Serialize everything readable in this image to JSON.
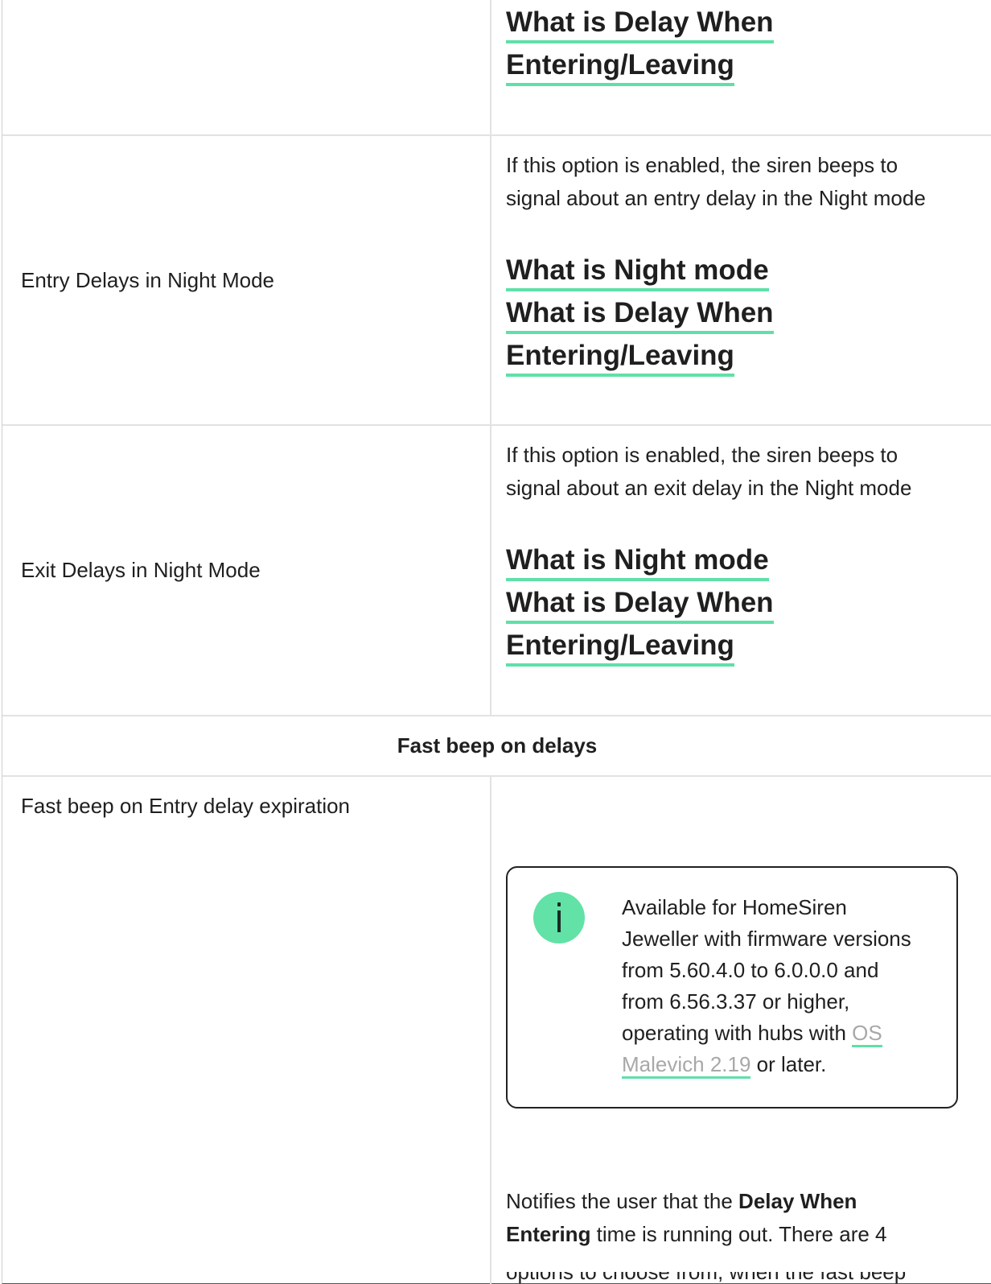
{
  "rows": {
    "top_links": [
      "What is Delay When",
      "Entering/Leaving"
    ],
    "entry_night": {
      "label": "Entry Delays in Night Mode",
      "desc_line1": "If this option is enabled, the siren beeps to",
      "desc_line2": "signal about an entry delay in the Night mode",
      "link1": "What is Night mode",
      "link2a": "What is Delay When",
      "link2b": "Entering/Leaving"
    },
    "exit_night": {
      "label": "Exit Delays in Night Mode",
      "desc_line1": "If this option is enabled, the siren beeps to",
      "desc_line2": "signal about an exit delay in the Night mode",
      "link1": "What is Night mode",
      "link2a": "What is Delay When",
      "link2b": "Entering/Leaving"
    },
    "section_title": "Fast beep on delays",
    "fast_beep": {
      "label": "Fast beep on Entry delay expiration",
      "note_line1": "Available for HomeSiren",
      "note_line2": "Jeweller with firmware versions",
      "note_line3": "from 5.60.4.0 to 6.0.0.0 and",
      "note_line4": "from 6.56.3.37 or higher,",
      "note_line5_pre": "operating with hubs with ",
      "note_link_a": "OS",
      "note_link_b": "Malevich 2.19",
      "note_line6_post": " or later.",
      "desc_pre": "Notifies the user that the ",
      "desc_bold1": "Delay When",
      "desc_bold2": "Entering",
      "desc_post": " time is running out. There are 4",
      "desc_cut": "options to choose from, when the fast beep"
    }
  },
  "colors": {
    "accent_underline": "#5fe0a8",
    "info_icon": "#62e2a6",
    "muted_link": "#a8a8a8"
  },
  "icons": {
    "info": "info-icon"
  }
}
